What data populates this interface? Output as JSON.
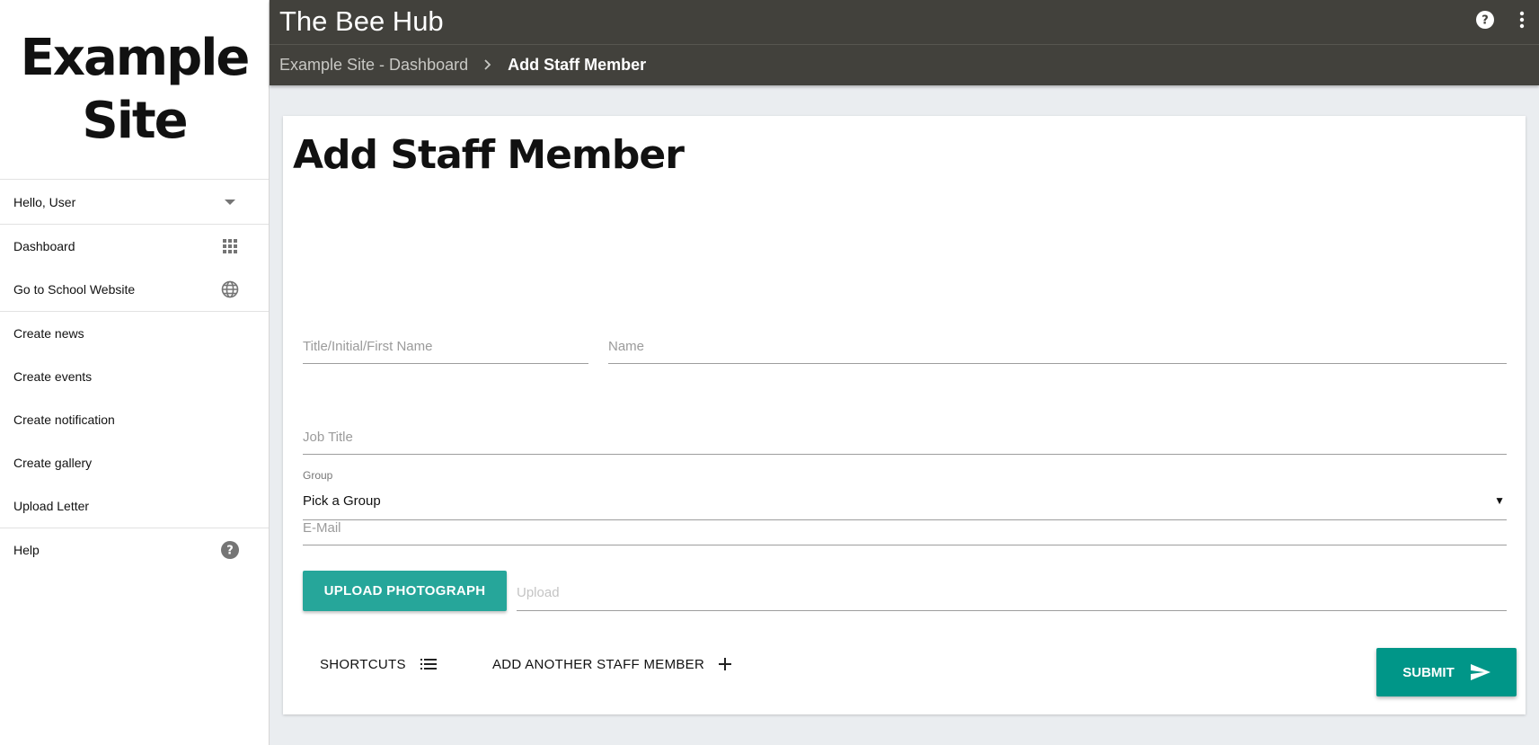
{
  "sidebar": {
    "site_title_line1": "Example",
    "site_title_line2": "Site",
    "user_greeting": "Hello, User",
    "nav": [
      {
        "label": "Dashboard",
        "icon": "grid-icon"
      },
      {
        "label": "Go to School Website",
        "icon": "globe-icon"
      }
    ],
    "create_items": [
      {
        "label": "Create news"
      },
      {
        "label": "Create events"
      },
      {
        "label": "Create notification"
      },
      {
        "label": "Create gallery"
      },
      {
        "label": "Upload Letter"
      }
    ],
    "help": {
      "label": "Help",
      "icon": "help-circle-icon"
    }
  },
  "topbar": {
    "app_title": "The Bee Hub",
    "breadcrumb": {
      "parent": "Example Site - Dashboard",
      "current": "Add Staff Member"
    }
  },
  "form": {
    "page_title": "Add Staff Member",
    "first_name_placeholder": "Title/Initial/First Name",
    "name_placeholder": "Name",
    "job_title_placeholder": "Job Title",
    "email_placeholder": "E-Mail",
    "group_label": "Group",
    "group_value": "Pick a Group",
    "upload_button": "UPLOAD PHOTOGRAPH",
    "upload_placeholder": "Upload",
    "shortcuts_label": "SHORTCUTS",
    "add_another_label": "ADD ANOTHER STAFF MEMBER",
    "submit_label": "SUBMIT"
  },
  "colors": {
    "topbar": "#42413c",
    "accent": "#26a69a",
    "submit": "#009688",
    "background": "#eaedf0"
  }
}
